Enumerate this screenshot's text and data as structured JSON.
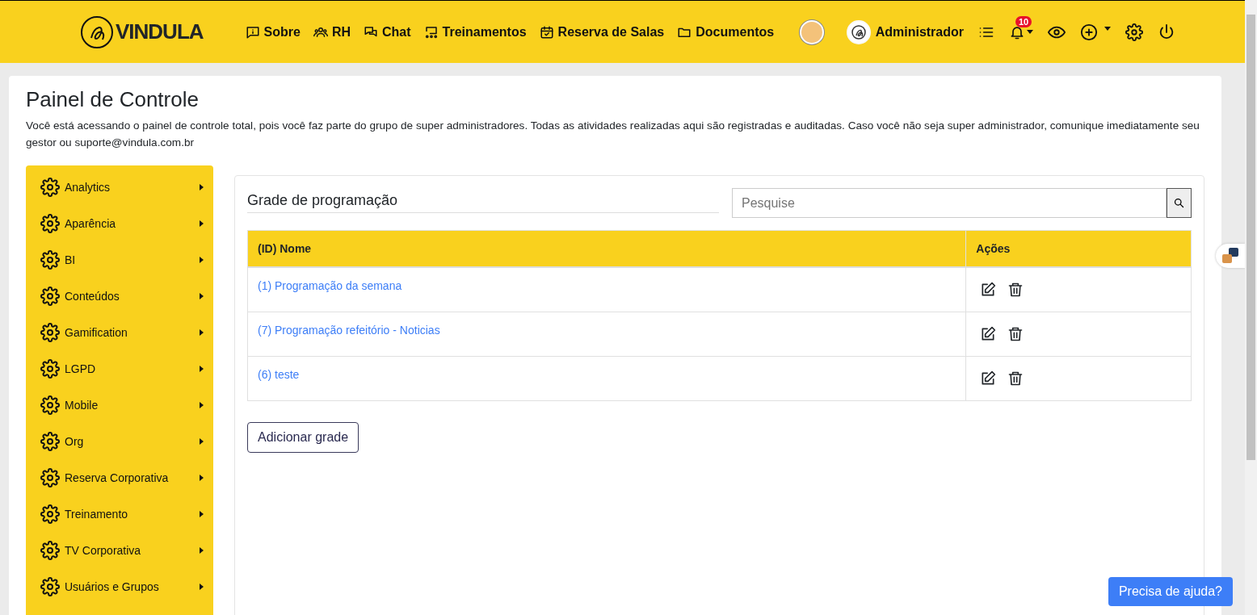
{
  "header": {
    "logo": "VINDULA",
    "nav": [
      {
        "label": "Sobre",
        "kind": "info"
      },
      {
        "label": "RH",
        "kind": "people"
      },
      {
        "label": "Chat",
        "kind": "chat"
      },
      {
        "label": "Treinamentos",
        "kind": "board"
      },
      {
        "label": "Reserva de Salas",
        "kind": "calendar"
      },
      {
        "label": "Documentos",
        "kind": "folder"
      }
    ],
    "user": "Administrador",
    "notification_count": "10"
  },
  "page": {
    "title": "Painel de Controle",
    "description": "Você está acessando o painel de controle total, pois você faz parte do grupo de super administradores. Todas as atividades realizadas aqui são registradas e auditadas. Caso você não seja super administrador, comunique imediatamente seu gestor ou suporte@vindula.com.br"
  },
  "sidebar": {
    "items": [
      "Analytics",
      "Aparência",
      "BI",
      "Conteúdos",
      "Gamification",
      "LGPD",
      "Mobile",
      "Org",
      "Reserva Corporativa",
      "Treinamento",
      "TV Corporativa",
      "Usuários e Grupos"
    ]
  },
  "panel": {
    "title": "Grade de programação",
    "search": {
      "placeholder": "Pesquise"
    },
    "table": {
      "columns": [
        "(ID) Nome",
        "Ações"
      ],
      "rows": [
        {
          "name": "(1) Programação da semana"
        },
        {
          "name": "(7) Programação refeitório - Noticias"
        },
        {
          "name": "(6) teste"
        }
      ]
    },
    "add_button": "Adicionar grade"
  },
  "help_button": "Precisa de ajuda?"
}
